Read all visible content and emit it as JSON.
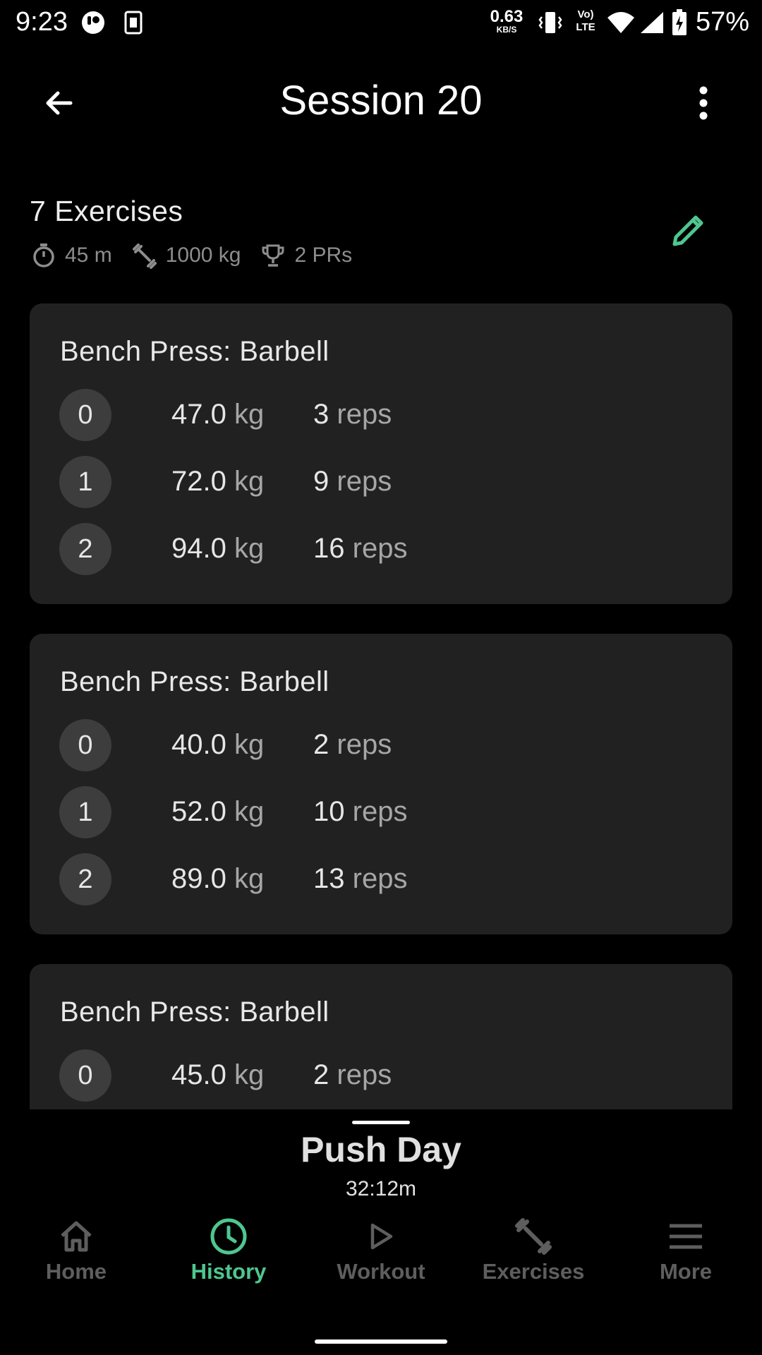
{
  "status_bar": {
    "time": "9:23",
    "net_speed_value": "0.63",
    "net_speed_unit": "KB/S",
    "volte_top": "Vo)",
    "volte_bottom": "LTE",
    "battery_percent": "57%"
  },
  "header": {
    "title": "Session 20",
    "back_icon": "arrow-left-icon",
    "menu_icon": "more-vert-icon"
  },
  "summary": {
    "title": "7 Exercises",
    "duration": "45 m",
    "volume": "1000 kg",
    "prs": "2 PRs",
    "edit_icon": "pencil-icon"
  },
  "exercises": [
    {
      "name": "Bench Press: Barbell",
      "sets": [
        {
          "index": "0",
          "weight": "47.0",
          "weight_unit": "kg",
          "reps": "3",
          "reps_unit": "reps"
        },
        {
          "index": "1",
          "weight": "72.0",
          "weight_unit": "kg",
          "reps": "9",
          "reps_unit": "reps"
        },
        {
          "index": "2",
          "weight": "94.0",
          "weight_unit": "kg",
          "reps": "16",
          "reps_unit": "reps"
        }
      ]
    },
    {
      "name": "Bench Press: Barbell",
      "sets": [
        {
          "index": "0",
          "weight": "40.0",
          "weight_unit": "kg",
          "reps": "2",
          "reps_unit": "reps"
        },
        {
          "index": "1",
          "weight": "52.0",
          "weight_unit": "kg",
          "reps": "10",
          "reps_unit": "reps"
        },
        {
          "index": "2",
          "weight": "89.0",
          "weight_unit": "kg",
          "reps": "13",
          "reps_unit": "reps"
        }
      ]
    },
    {
      "name": "Bench Press: Barbell",
      "sets": [
        {
          "index": "0",
          "weight": "45.0",
          "weight_unit": "kg",
          "reps": "2",
          "reps_unit": "reps"
        }
      ]
    }
  ],
  "active_workout": {
    "title": "Push Day",
    "timer": "32:12m"
  },
  "bottom_nav": {
    "items": [
      {
        "label": "Home",
        "icon": "home-icon",
        "active": false
      },
      {
        "label": "History",
        "icon": "clock-icon",
        "active": true
      },
      {
        "label": "Workout",
        "icon": "play-icon",
        "active": false
      },
      {
        "label": "Exercises",
        "icon": "dumbbell-icon",
        "active": false
      },
      {
        "label": "More",
        "icon": "menu-icon",
        "active": false
      }
    ]
  },
  "colors": {
    "accent": "#4fc690",
    "background": "#000000",
    "card": "#212121",
    "badge": "#3d3d3d",
    "muted": "#8d8d8d",
    "inactive_nav": "#5e5e5e"
  }
}
